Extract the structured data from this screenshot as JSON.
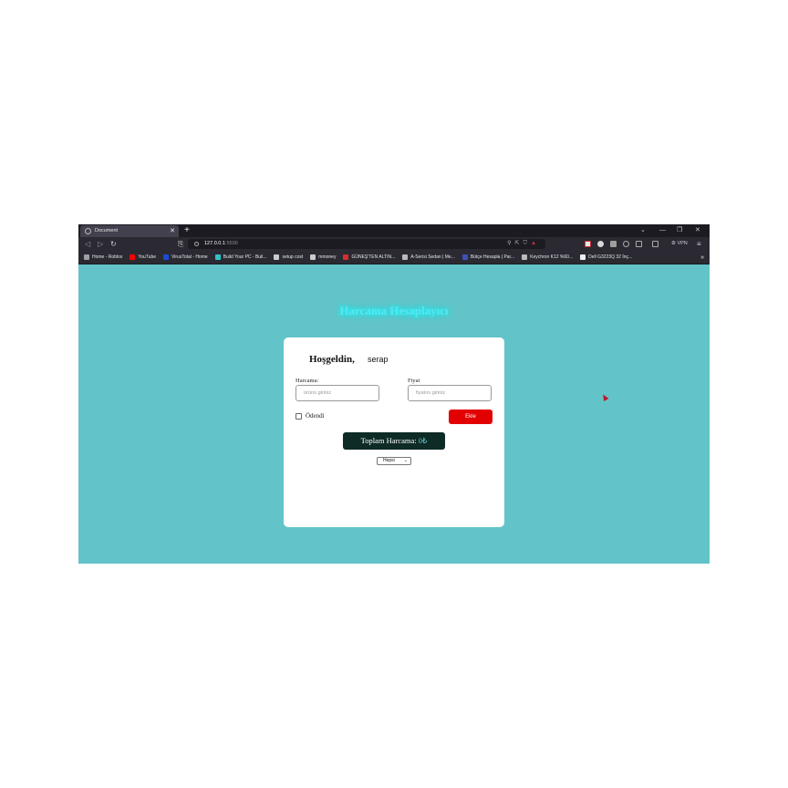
{
  "browser": {
    "tab_title": "Document",
    "url_host": "127.0.0.1",
    "url_port": ":5500",
    "vpn_label": "VPN",
    "bookmarks": [
      {
        "label": "Home - Roblox",
        "color": "#9aa0a6"
      },
      {
        "label": "YouTube",
        "color": "#ff0000"
      },
      {
        "label": "VirusTotal - Home",
        "color": "#1a4bd6"
      },
      {
        "label": "Build Your PC - Buil...",
        "color": "#2fc4c4"
      },
      {
        "label": "setup cost",
        "color": "#cccccc"
      },
      {
        "label": "mmoney",
        "color": "#cccccc"
      },
      {
        "label": "GÜNEŞ'TEN ALTIN...",
        "color": "#d32f2f"
      },
      {
        "label": "A-Serisi Sedan | Me...",
        "color": "#bbbbbb"
      },
      {
        "label": "Bütçe Hesapla | Par...",
        "color": "#3f51b5"
      },
      {
        "label": "Keychron K12 %60...",
        "color": "#bbbbbb"
      },
      {
        "label": "Dell G3223Q 32 İnç...",
        "color": "#eeeeee"
      }
    ]
  },
  "app": {
    "title": "Harcama Hesaplayıcı",
    "welcome": "Hoşgeldin,",
    "username": "serap",
    "expense_label": "Harcama:",
    "expense_placeholder": "ürünü giriniz",
    "price_label": "Fiyat",
    "price_placeholder": "fiyatını giriniz",
    "paid_label": "Ödendi",
    "add_button": "Ekle",
    "total_label": "Toplam Harcama: ",
    "total_amount": "0₺",
    "filter_selected": "Hepsi"
  },
  "colors": {
    "page_bg": "#62c4c8",
    "accent_red": "#e30000",
    "total_bg": "#0e2b26",
    "title_glow": "#00ffff"
  }
}
